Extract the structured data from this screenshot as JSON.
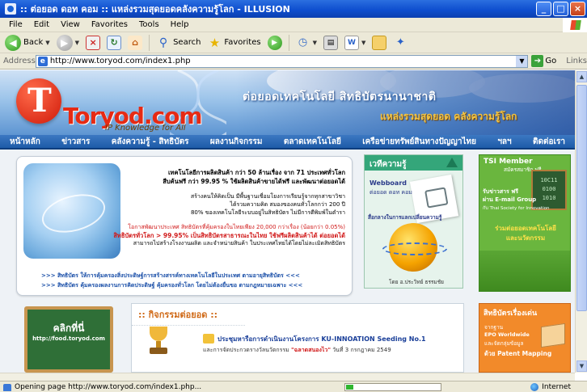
{
  "window": {
    "title": ":: ต่อยอด ดอท คอม :: แหล่งรวมสุดยอดคลังความรู้โลก - ILLUSION",
    "buttons": {
      "minimize": "_",
      "maximize": "□",
      "close": "×"
    }
  },
  "menu": [
    "File",
    "Edit",
    "View",
    "Favorites",
    "Tools",
    "Help"
  ],
  "toolbar": {
    "back_label": "Back",
    "search_label": "Search",
    "favorites_label": "Favorites",
    "icons": [
      "back-icon",
      "forward-icon",
      "stop-icon",
      "refresh-icon",
      "home-icon",
      "search-icon",
      "favorites-star-icon",
      "media-icon",
      "history-icon",
      "mail-icon",
      "print-icon",
      "edit-icon",
      "folder-icon",
      "messenger-icon"
    ]
  },
  "address": {
    "label": "Address",
    "url": "http://www.toryod.com/index1.php",
    "go_label": "Go",
    "links_label": "Links"
  },
  "banner": {
    "logo_text": "Toryod.com",
    "tagline": "IP Knowledge for All",
    "headline": "ต่อยอดเทคโนโลยี สิทธิบัตรนานาชาติ",
    "subline": "แหล่งรวมสุดยอด คลังความรู้โลก"
  },
  "nav": [
    "หน้าหลัก",
    "ข่าวสาร",
    "คลังความรู้ - สิทธิบัตร",
    "ผลงานกิจกรรม",
    "ตลาดเทคโนโลยี",
    "เครือข่ายทรัพย์สินทางปัญญาไทย",
    "ฯลฯ",
    "ติดต่อเรา"
  ],
  "promo": {
    "line1": "เทคโนโลยีการผลิตสินค้า กว่า 50 ล้านเรื่อง จาก 71 ประเทศทั่วโลก",
    "line2": "สืบค้นฟรี กว่า 99.95 % ใช้ผลิตสินค้าขายได้ฟรี และพัฒนาต่อยอดได้",
    "line3": "สร้างคนให้คิดเป็น มีพื้นฐานเชื่อมโยงการเรียนรู้จากทุกสาขาวิชา",
    "line4": "ได้รวมความคิด สมองของคนทั่วโลกกว่า 200 ปี",
    "line5": "80% ของเทคโนโลยีระบบอยู่ในสิทธิบัตร ไม่มีการตีพิมพ์ในตำรา",
    "line6": "โอกาสพัฒนาประเทศ สิทธิบัตรที่คุ้มครองในไทยเพียง 20,000 กว่าเรื่อง (น้อยกว่า 0.05%)",
    "line7": "สิทธิบัตรทั่วโลก > 99.95% เป็นสิทธิบัตรสาธารณะในไทย ใช้ฟรีผลิตสินค้าได้ ต่อยอดได้",
    "line8": "สามารถไปสร้างโรงงานผลิต และจำหน่ายสินค้า ในประเทศไทยได้โดยไม่ละเมิดสิทธิบัตร",
    "bullet1": ">>> สิทธิบัตร ให้การคุ้มครองสิ่งประดิษฐ์การสร้างสรรค์ทางเทคโนโลยีในประเทศ ตามอายุสิทธิบัตร <<<",
    "bullet2": ">>> สิทธิบัตร คุ้มครองผลงานการคิดประดิษฐ์ คุ้มครองทั่วโลก โดยไม่ต้องยื่นขอ ตามกฎหมายเฉพาะ <<<"
  },
  "knowledge": {
    "title": "เวทีความรู้",
    "webboard": "Webboard",
    "domain": "ต่อยอด ดอท คอม",
    "cta": "สื่อกลางในการแลกเปลี่ยนความรู้",
    "credit": "โดย อ.ประวิทย์ ธรรมชัย"
  },
  "tsi": {
    "title": "TSI Member",
    "subtitle": "สมัครสมาชิก ฟรี",
    "board": [
      "10C11",
      "0100",
      "1010"
    ],
    "t1": "รับข่าวสาร ฟรี",
    "t2": "ผ่าน E-mail Group",
    "t3": "กับ Thai Society for Innovation",
    "t4": "ร่วมต่อยอดเทคโนโลยี",
    "t5": "และนวัตกรรม"
  },
  "food": {
    "title": "คลิกที่นี่",
    "url": "http://food.toryod.com"
  },
  "activity": {
    "title": ":: กิจกรรมต่อยอด ::",
    "headline": "ประชุมหารือการดำเนินงานโครงการ KU-INNOATION Seeding No.1",
    "detail_a": "และการจัดประกวดรางวัลนวัตกรรม",
    "detail_b": "\"ฉลาดสนองไว\"",
    "detail_c": "วันที่ 3 กรกฎาคม 2549"
  },
  "patent": {
    "title": "สิทธิบัตรเรื่องเด่น",
    "p1": "จากฐาน",
    "p2": "EPO Worldwide",
    "p3": "และจัดกลุ่มข้อมูล",
    "p4": "ด้วย Patent Mapping"
  },
  "status": {
    "text": "Opening page http://www.toryod.com/index1.php...",
    "zone": "Internet",
    "progress": 0.08
  },
  "colors": {
    "titlebar": "#0f4fcf",
    "nav": "#1d5ba8",
    "knowledge_green": "#34a67a",
    "tsi_green": "#6ab63e",
    "patent_orange": "#f28a2a"
  }
}
